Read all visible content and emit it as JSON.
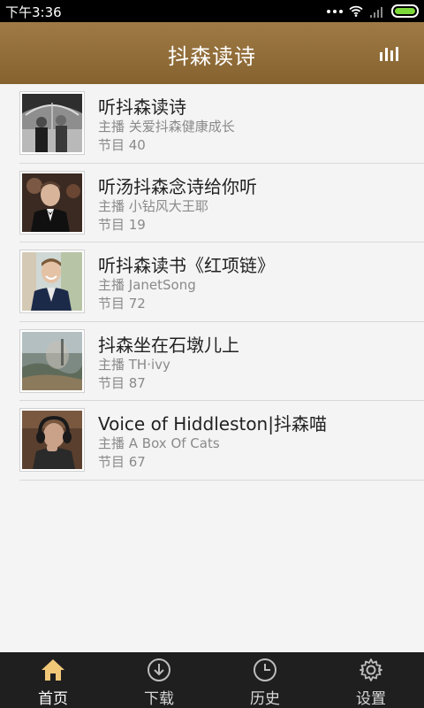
{
  "status_bar": {
    "time": "下午3:36"
  },
  "header": {
    "title": "抖森读诗",
    "right_icon": "equalizer-icon"
  },
  "list": [
    {
      "title": "听抖森读诗",
      "host": "主播 关爱抖森健康成长",
      "count": "节目 40"
    },
    {
      "title": "听汤抖森念诗给你听",
      "host": "主播 小钻风大王耶",
      "count": "节目 19"
    },
    {
      "title": "听抖森读书《红项链》",
      "host": "主播 JanetSong",
      "count": "节目 72"
    },
    {
      "title": "抖森坐在石墩儿上",
      "host": "主播 TH·ivy",
      "count": "节目 87"
    },
    {
      "title": "Voice of Hiddleston|抖森喵",
      "host": "主播 A Box Of Cats",
      "count": "节目 67"
    }
  ],
  "bottom_nav": [
    {
      "label": "首页",
      "icon": "home-icon",
      "active": true
    },
    {
      "label": "下载",
      "icon": "download-icon",
      "active": false
    },
    {
      "label": "历史",
      "icon": "clock-icon",
      "active": false
    },
    {
      "label": "设置",
      "icon": "gear-icon",
      "active": false
    }
  ],
  "colors": {
    "header": "#92703c",
    "status_bar": "#000000",
    "bottom_nav": "#1f1f1f",
    "battery": "#7dd83a"
  }
}
